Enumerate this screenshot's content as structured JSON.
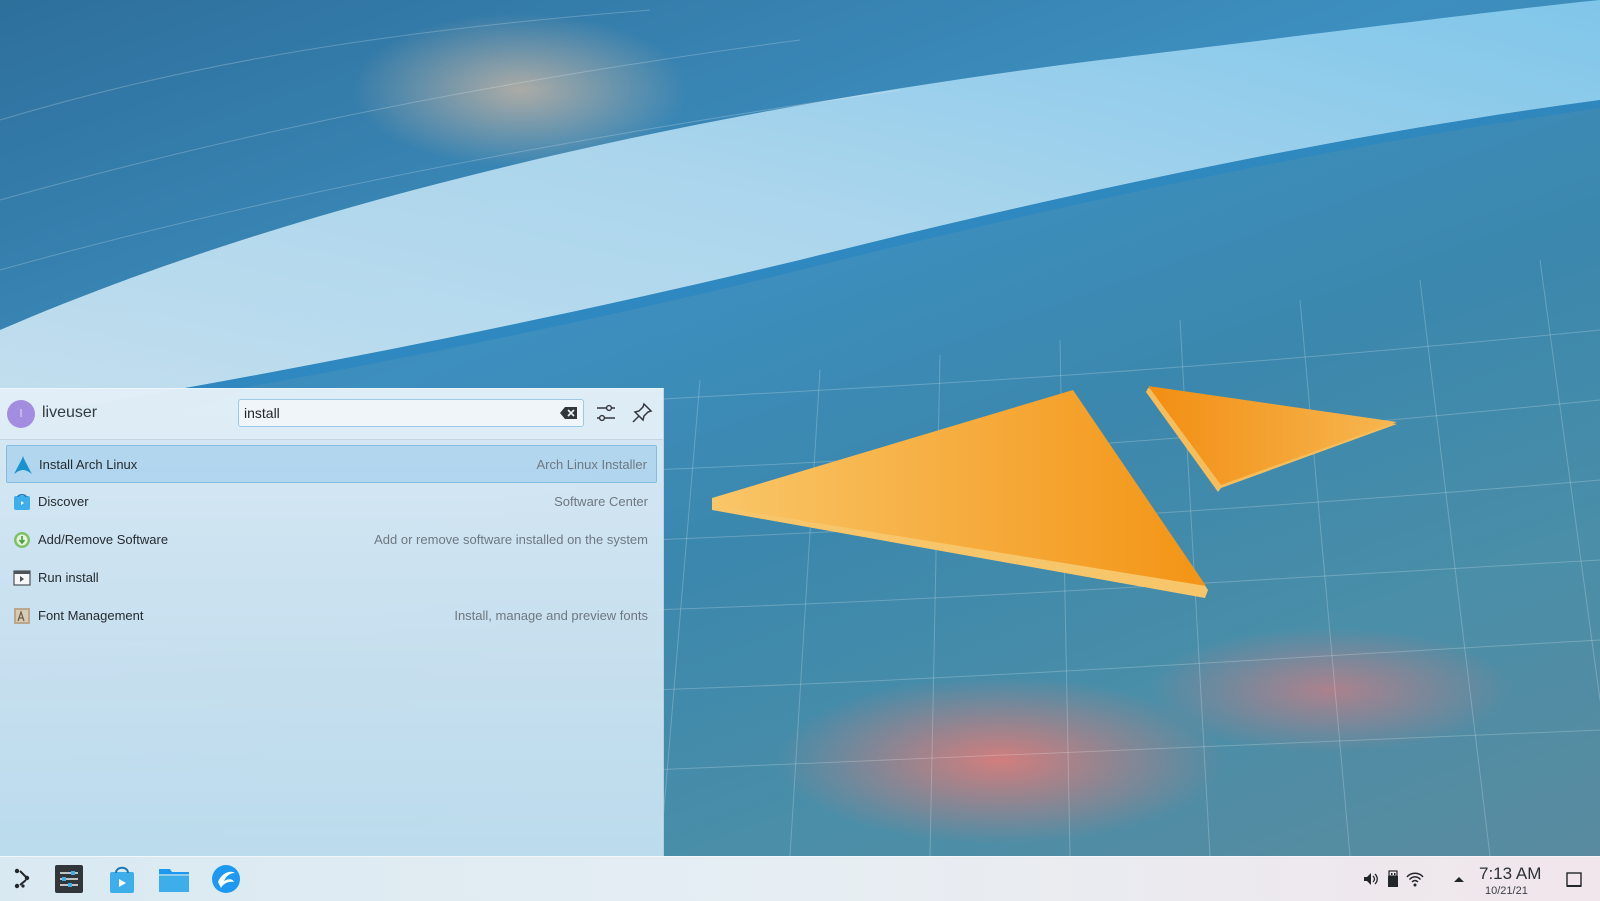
{
  "launcher": {
    "user": {
      "avatar_initial": "l",
      "name": "liveuser"
    },
    "search": {
      "value": "install"
    },
    "results": [
      {
        "title": "Install Arch Linux",
        "subtitle": "Arch Linux Installer",
        "icon": "arch-linux-icon",
        "selected": true
      },
      {
        "title": "Discover",
        "subtitle": "Software Center",
        "icon": "discover-icon",
        "selected": false
      },
      {
        "title": "Add/Remove Software",
        "subtitle": "Add or remove software installed on the system",
        "icon": "package-manager-icon",
        "selected": false
      },
      {
        "title": "Run install",
        "subtitle": "",
        "icon": "run-command-icon",
        "selected": false
      },
      {
        "title": "Font Management",
        "subtitle": "Install, manage and preview fonts",
        "icon": "font-management-icon",
        "selected": false
      }
    ]
  },
  "taskbar": {
    "apps": [
      "application-launcher-icon",
      "system-settings-icon",
      "discover-icon",
      "file-manager-icon",
      "web-browser-icon"
    ],
    "tray": [
      "volume-icon",
      "removable-device-icon",
      "wifi-icon",
      "tray-expand-icon"
    ],
    "clock": {
      "time": "7:13 AM",
      "date": "10/21/21"
    }
  },
  "colors": {
    "accent": "#3daee9",
    "orange": "#f39c1f",
    "selection": "#84bde2"
  }
}
